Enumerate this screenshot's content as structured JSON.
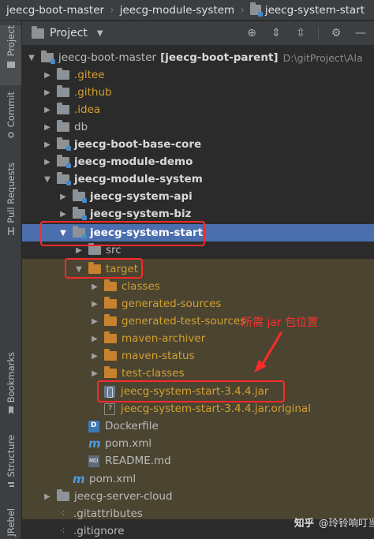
{
  "breadcrumb": {
    "items": [
      "jeecg-boot-master",
      "jeecg-module-system",
      "jeecg-system-start"
    ]
  },
  "tool_stripe": {
    "tabs": [
      "Project",
      "Commit",
      "Pull Requests",
      "Bookmarks",
      "Structure",
      "JRebel"
    ]
  },
  "panel": {
    "title": "Project",
    "icons": [
      "locate-icon",
      "expand-all-icon",
      "collapse-all-icon",
      "settings-icon",
      "minimize-icon"
    ]
  },
  "tree": {
    "root_name": "jeecg-boot-master",
    "root_module": "[jeecg-boot-parent]",
    "root_path": "D:\\gitProject\\Ala",
    "items": {
      "gitee": ".gitee",
      "github": ".github",
      "idea": ".idea",
      "db": "db",
      "base_core": "jeecg-boot-base-core",
      "module_demo": "jeecg-module-demo",
      "module_system": "jeecg-module-system",
      "system_api": "jeecg-system-api",
      "system_biz": "jeecg-system-biz",
      "system_start": "jeecg-system-start",
      "src": "src",
      "target": "target",
      "classes": "classes",
      "generated_sources": "generated-sources",
      "generated_test_sources": "generated-test-sources",
      "maven_archiver": "maven-archiver",
      "maven_status": "maven-status",
      "test_classes": "test-classes",
      "jar": "jeecg-system-start-3.4.4.jar",
      "jar_original": "jeecg-system-start-3.4.4.jar.original",
      "dockerfile": "Dockerfile",
      "pom_start": "pom.xml",
      "readme": "README.md",
      "pom_system": "pom.xml",
      "server_cloud": "jeecg-server-cloud",
      "gitattributes": ".gitattributes",
      "gitignore": ".gitignore"
    }
  },
  "annotation": "所需 jar 包位置",
  "watermark": {
    "site": "知乎",
    "author": "@玲铃响叮当"
  },
  "colors": {
    "selection": "#4b6eaf",
    "annotation_red": "#ff2a2a",
    "excluded_folder": "#c7822e",
    "excluded_text": "#d3a030"
  }
}
